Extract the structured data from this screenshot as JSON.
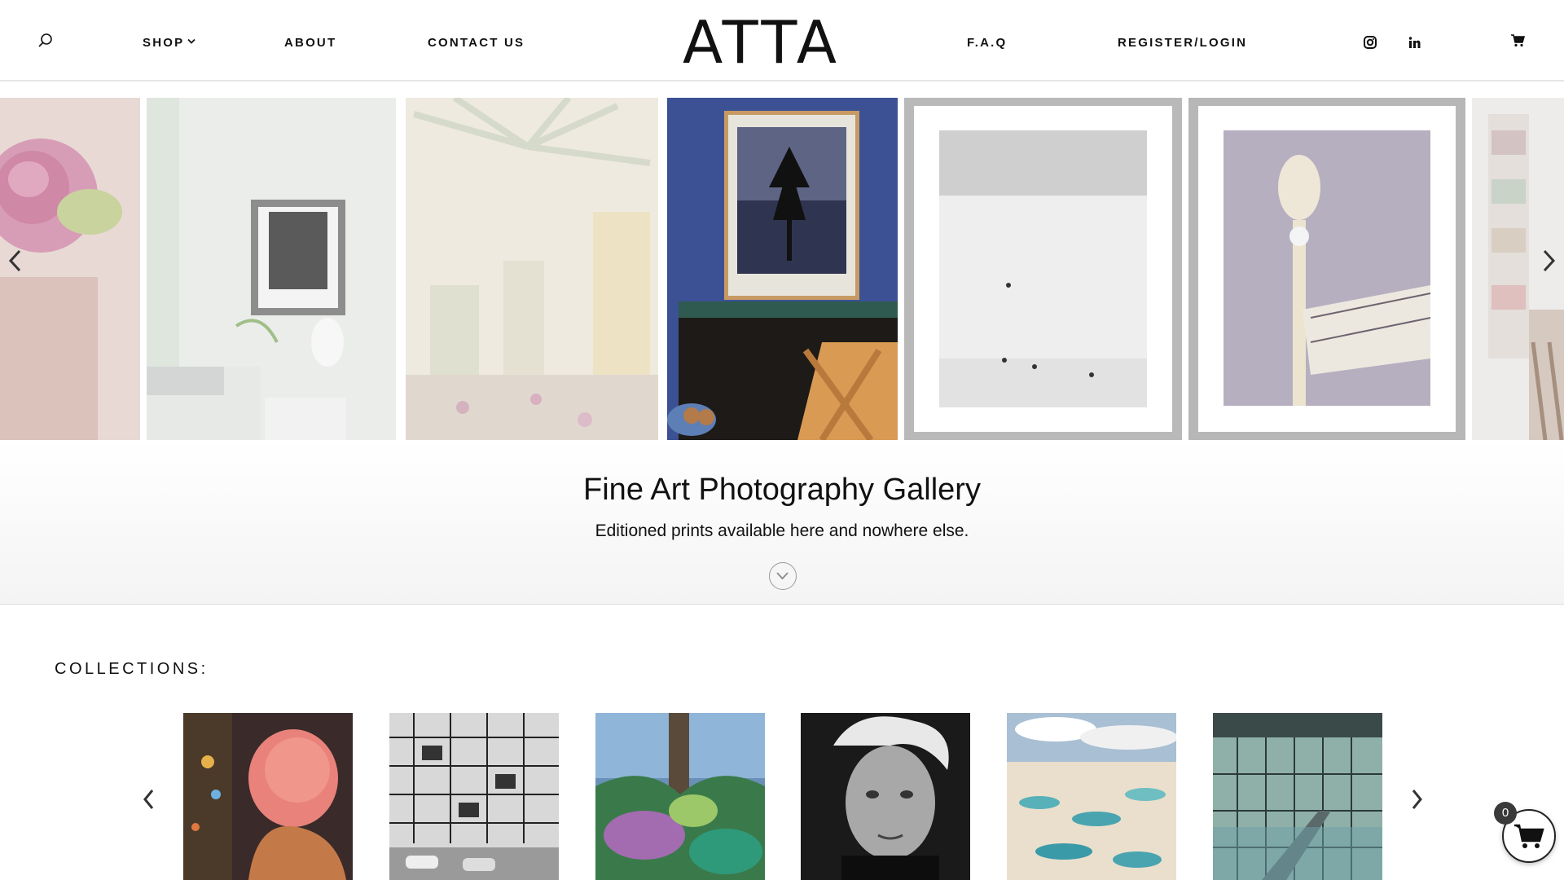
{
  "header": {
    "logo": "ATTA",
    "nav_left": [
      "SHOP",
      "ABOUT",
      "CONTACT US"
    ],
    "nav_right": [
      "F.A.Q",
      "REGISTER/LOGIN"
    ],
    "icons": [
      "search-icon",
      "chevron-down-icon",
      "instagram-icon",
      "linkedin-icon",
      "cart-icon"
    ]
  },
  "hero": {
    "title": "Fine Art Photography Gallery",
    "subtitle": "Editioned prints available here and nowhere else.",
    "slides": [
      "pink-rose-print",
      "bedroom-framed-print",
      "palm-fronds-print",
      "tree-silhouette-framed-print",
      "plaza-walkers-framed-print",
      "clock-tower-framed-print",
      "bookshelf-room-print"
    ]
  },
  "collections": {
    "label": "COLLECTIONS:",
    "items": [
      "red-hair-night",
      "facade-black-white",
      "tropical-palms",
      "portrait-grey-hair",
      "sand-dunes-lagoons",
      "glass-atrium"
    ]
  },
  "cart": {
    "count": "0"
  },
  "colors": {
    "accent": "#111111",
    "header_border": "#e6e6e6",
    "blue_wall": "#3a4f92"
  }
}
